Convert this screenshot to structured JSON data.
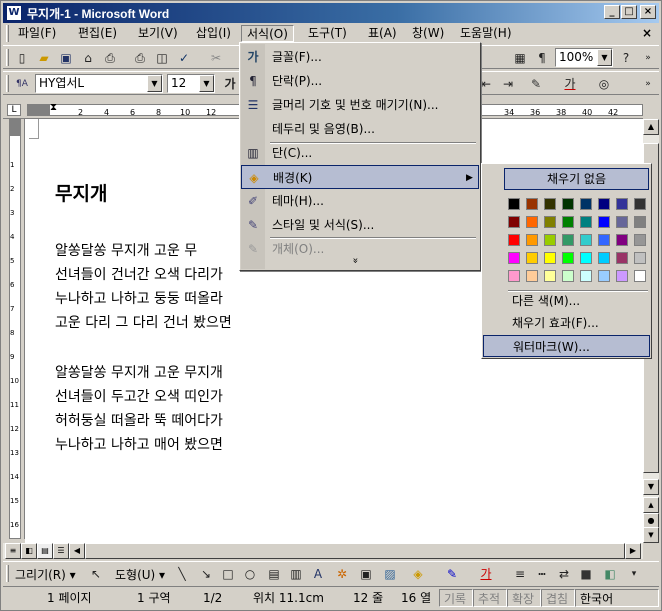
{
  "window": {
    "title": "무지개-1 - Microsoft Word",
    "icon_label": "W",
    "controls": [
      "_",
      "□",
      "×"
    ]
  },
  "menubar": {
    "items": [
      "파일(F)",
      "편집(E)",
      "보기(V)",
      "삽입(I)",
      "서식(O)",
      "도구(T)",
      "표(A)",
      "창(W)",
      "도움말(H)"
    ],
    "close_doc": "×"
  },
  "toolbar": {
    "zoom": "100%",
    "font_name": "HY엽서L",
    "font_size": "12"
  },
  "ruler": {
    "ticks": [
      "2",
      "4",
      "6",
      "8",
      "10",
      "12",
      "34",
      "36",
      "38",
      "40",
      "42"
    ]
  },
  "vruler": {
    "ticks": [
      "1",
      "2",
      "3",
      "4",
      "5",
      "6",
      "7",
      "8",
      "9",
      "10",
      "11",
      "12",
      "13",
      "14",
      "15",
      "16"
    ]
  },
  "document": {
    "title": "무지개",
    "stanza1": [
      "알쏭달쏭 무지개 고운 무",
      "선녀들이 건너간 오색 다리가",
      "누나하고 나하고 둥둥 떠올라",
      "고운 다리 그 다리 건너 봤으면"
    ],
    "stanza2": [
      "알쏭달쏭 무지개 고운 무지개",
      "선녀들이 두고간 오색 띠인가",
      "허허둥실 떠올라 뚝 떼어다가",
      "누나하고 나하고 매어 봤으면"
    ]
  },
  "format_menu": {
    "items": [
      {
        "icon": "가",
        "label": "글꼴(F)..."
      },
      {
        "icon": "¶",
        "label": "단락(P)..."
      },
      {
        "icon": "☰",
        "label": "글머리 기호 및 번호 매기기(N)..."
      },
      {
        "icon": "",
        "label": "테두리 및 음영(B)..."
      },
      {
        "icon": "▥",
        "label": "단(C)..."
      },
      {
        "icon": "◈",
        "label": "배경(K)",
        "arrow": "▶"
      },
      {
        "icon": "✐",
        "label": "테마(H)..."
      },
      {
        "icon": "✎",
        "label": "스타일 및 서식(S)..."
      },
      {
        "icon": "✎",
        "label": "개체(O)..."
      }
    ],
    "expand": "»"
  },
  "background_submenu": {
    "no_fill": "채우기 없음",
    "more_colors": "다른 색(M)...",
    "fill_effects": "채우기 효과(F)...",
    "watermark": "워터마크(W)...",
    "colors": [
      [
        "#000000",
        "#993300",
        "#333300",
        "#003300",
        "#003366",
        "#000080",
        "#333399",
        "#333333"
      ],
      [
        "#800000",
        "#ff6600",
        "#808000",
        "#008000",
        "#008080",
        "#0000ff",
        "#666699",
        "#808080"
      ],
      [
        "#ff0000",
        "#ff9900",
        "#99cc00",
        "#339966",
        "#33cccc",
        "#3366ff",
        "#800080",
        "#969696"
      ],
      [
        "#ff00ff",
        "#ffcc00",
        "#ffff00",
        "#00ff00",
        "#00ffff",
        "#00ccff",
        "#993366",
        "#c0c0c0"
      ],
      [
        "#ff99cc",
        "#ffcc99",
        "#ffff99",
        "#ccffcc",
        "#ccffff",
        "#99ccff",
        "#cc99ff",
        "#ffffff"
      ]
    ]
  },
  "drawbar": {
    "draw": "그리기(R) ▾",
    "autoshapes": "도형(U) ▾"
  },
  "statusbar": {
    "page": "1 페이지",
    "section": "1 구역",
    "pages": "1/2",
    "position": "위치 11.1cm",
    "line": "12 줄",
    "column": "16 열",
    "rec": "기록",
    "trk": "추적",
    "ext": "확장",
    "ovr": "겹침",
    "language": "한국어"
  }
}
